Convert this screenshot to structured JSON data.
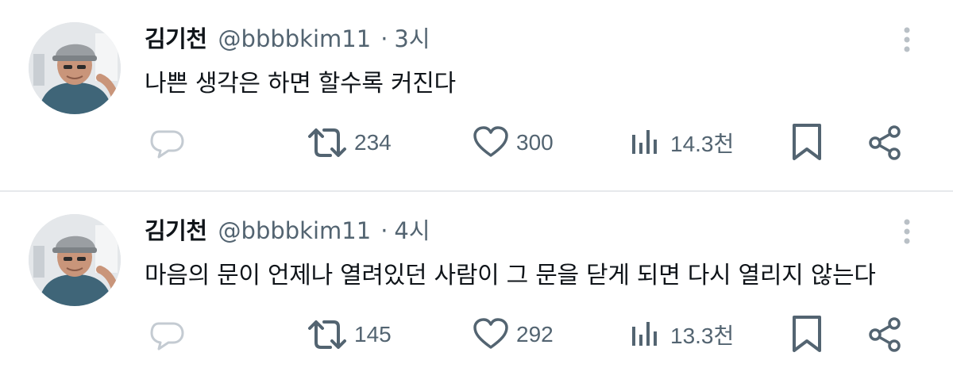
{
  "tweets": [
    {
      "author_name": "김기천",
      "handle": "@bbbbkim11",
      "separator": "·",
      "time": "3시",
      "text": "나쁜 생각은 하면 할수록 커진다",
      "retweets": "234",
      "likes": "300",
      "views": "14.3천"
    },
    {
      "author_name": "김기천",
      "handle": "@bbbbkim11",
      "separator": "·",
      "time": "4시",
      "text": "마음의 문이 언제나 열려있던 사람이 그 문을 닫게 되면 다시 열리지 않는다",
      "retweets": "145",
      "likes": "292",
      "views": "13.3천"
    }
  ],
  "icons": {
    "reply": "reply-icon",
    "retweet": "retweet-icon",
    "like": "heart-icon",
    "views": "views-chart-icon",
    "bookmark": "bookmark-icon",
    "share": "share-icon",
    "more": "more-vertical-icon"
  },
  "colors": {
    "text_primary": "#0f1419",
    "text_secondary": "#536471",
    "reply_icon": "#c4cbd2",
    "divider": "#e6e9ec"
  }
}
